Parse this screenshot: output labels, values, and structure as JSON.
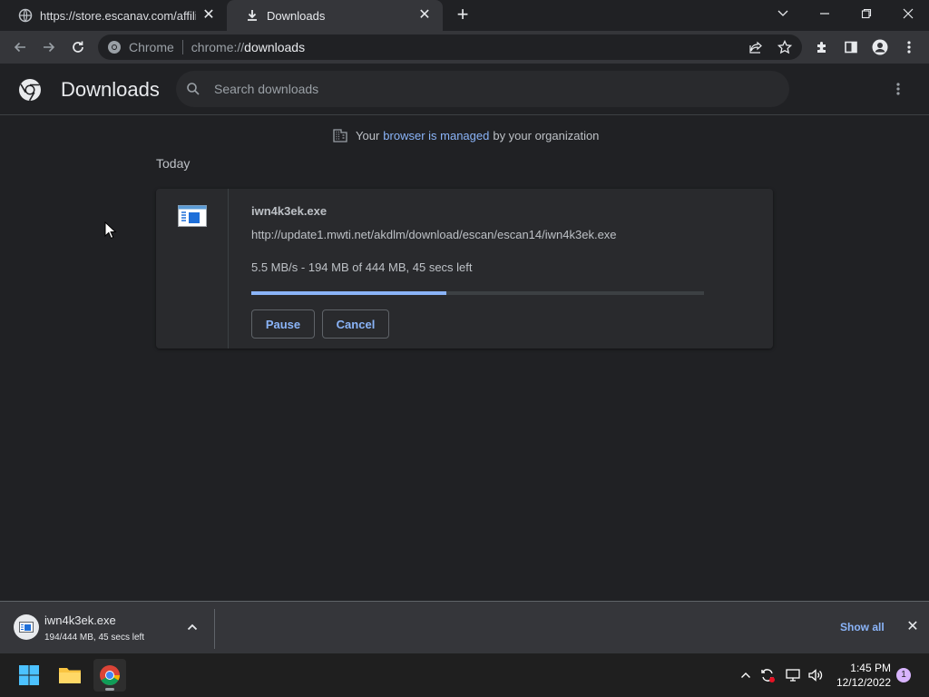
{
  "tabs": [
    {
      "title": "https://store.escanav.com/affiliat",
      "icon": "globe-icon"
    },
    {
      "title": "Downloads",
      "icon": "download-icon"
    }
  ],
  "omnibox": {
    "site_label": "Chrome",
    "url_scheme": "chrome://",
    "url_path": "downloads"
  },
  "page": {
    "title": "Downloads",
    "search_placeholder": "Search downloads",
    "managed_prefix": "Your",
    "managed_link": "browser is managed",
    "managed_suffix": "by your organization",
    "date_header": "Today"
  },
  "download": {
    "filename": "iwn4k3ek.exe",
    "url": "http://update1.mwti.net/akdlm/download/escan/escan14/iwn4k3ek.exe",
    "status": "5.5 MB/s - 194 MB of 444 MB, 45 secs left",
    "progress": 0.43,
    "pause_label": "Pause",
    "cancel_label": "Cancel"
  },
  "shelf": {
    "filename": "iwn4k3ek.exe",
    "status": "194/444 MB, 45 secs left",
    "show_all": "Show all"
  },
  "taskbar": {
    "time": "1:45 PM",
    "date": "12/12/2022",
    "notification_count": "1"
  },
  "colors": {
    "accent": "#8ab4f8",
    "background": "#202124",
    "card": "#292a2d"
  }
}
